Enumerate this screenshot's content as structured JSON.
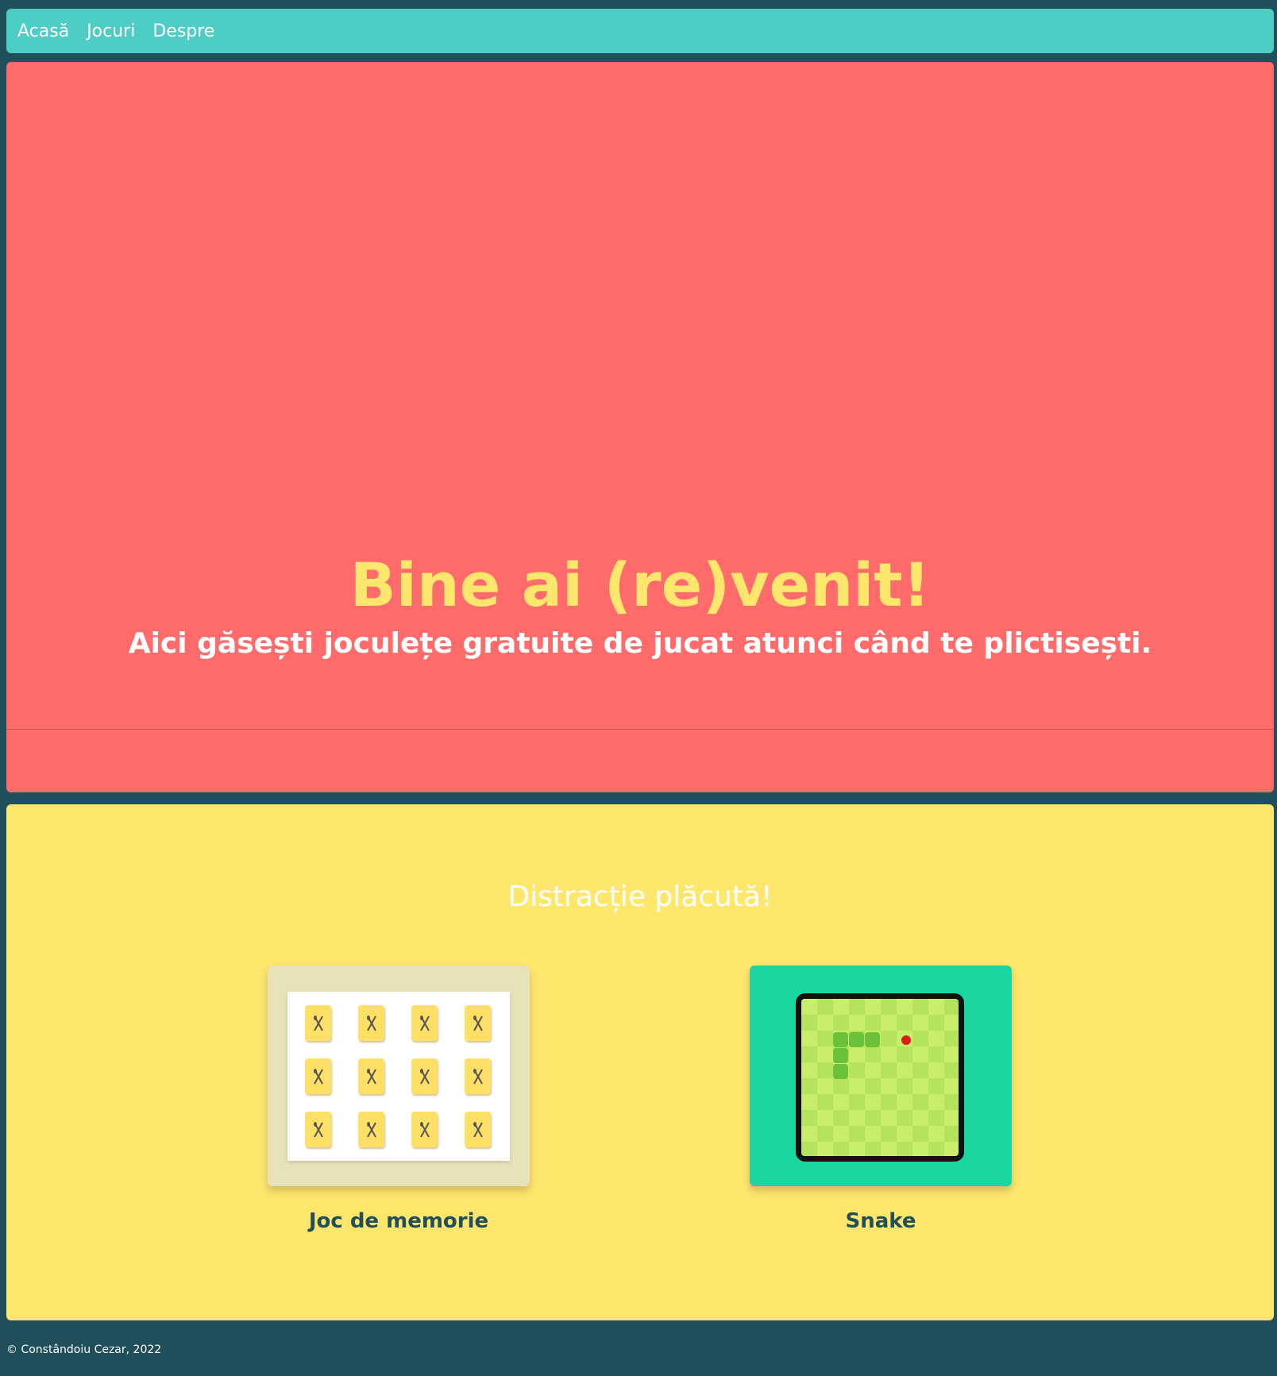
{
  "nav": {
    "links": [
      "Acasă",
      "Jocuri",
      "Despre"
    ]
  },
  "hero": {
    "title": "Bine ai (re)venit!",
    "subtitle": "Aici găsești joculețe gratuite de jucat atunci când te plictisești."
  },
  "games": {
    "heading": "Distracție plăcută!",
    "items": [
      {
        "label": "Joc de memorie",
        "thumbnail_icon": "memory-cards-icon"
      },
      {
        "label": "Snake",
        "thumbnail_icon": "snake-board-icon"
      }
    ]
  },
  "footer": {
    "text": "© Constândoiu Cezar, 2022"
  },
  "colors": {
    "background": "#1e4f5a",
    "navbar": "#4ecdc4",
    "hero": "#ff6b6b",
    "accent_yellow": "#ffe66d",
    "snake_card": "#1ad6a1",
    "memory_card": "#e8e2b8"
  }
}
